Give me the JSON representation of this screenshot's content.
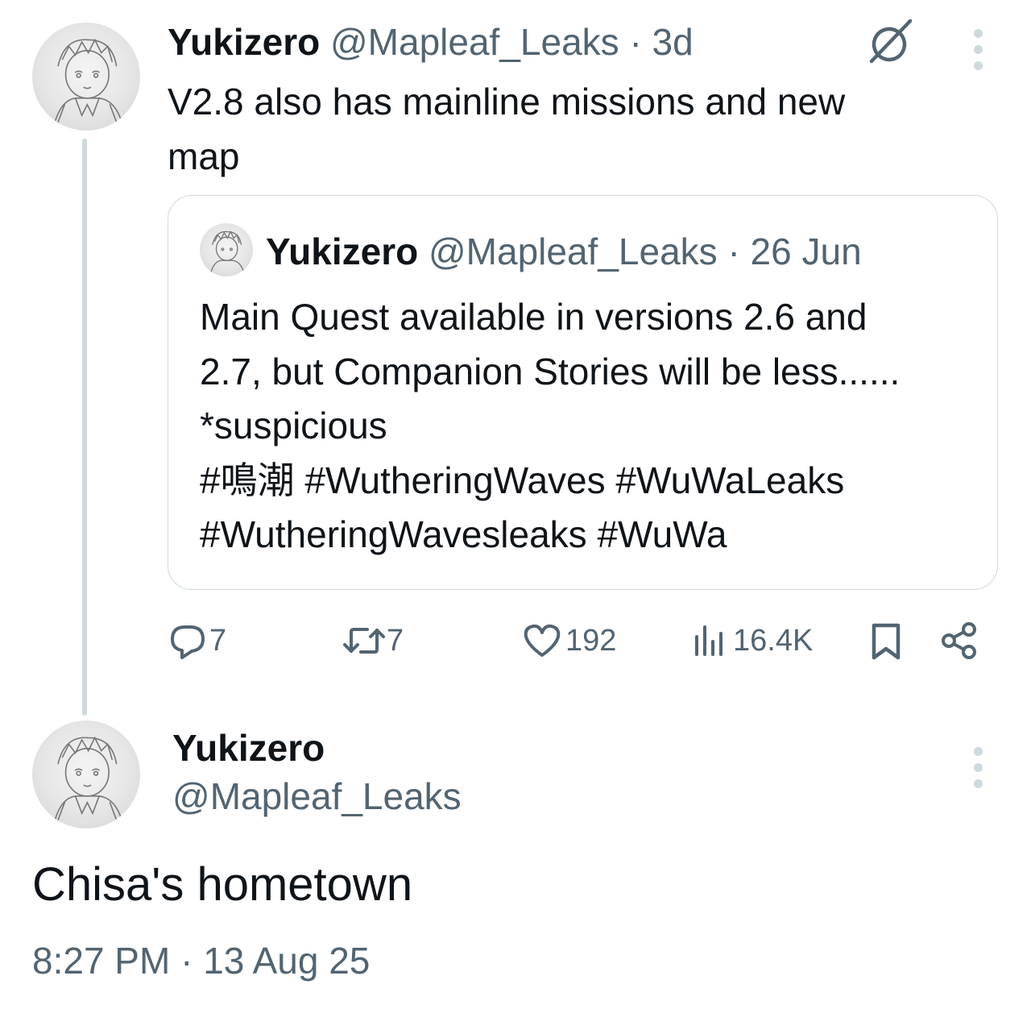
{
  "reply_tweet": {
    "display_name": "Yukizero",
    "handle_and_time": "@Mapleaf_Leaks · 3d",
    "text_line1": "V2.8 also has mainline missions and new",
    "text_line2": "map",
    "quoted": {
      "display_name": "Yukizero",
      "handle_and_time": "@Mapleaf_Leaks · 26 Jun",
      "lines": [
        "Main Quest available in versions 2.6 and",
        "2.7, but Companion Stories will be less......",
        "*suspicious",
        "#鳴潮 #WutheringWaves #WuWaLeaks",
        "#WutheringWavesleaks #WuWa"
      ]
    },
    "actions": {
      "replies": "7",
      "reposts": "7",
      "likes": "192",
      "views": "16.4K"
    }
  },
  "main_tweet": {
    "display_name": "Yukizero",
    "handle": "@Mapleaf_Leaks",
    "text": "Chisa's hometown",
    "timestamp": "8:27 PM · 13 Aug 25"
  },
  "icons": {
    "grok": "slashed-circle-icon",
    "more": "vertical-dots-icon",
    "reply": "speech-bubble-icon",
    "repost": "repost-arrows-icon",
    "like": "heart-icon",
    "views": "bar-chart-icon",
    "bookmark": "bookmark-icon",
    "share": "share-icon"
  },
  "colors": {
    "text": "#0f1419",
    "muted": "#536471",
    "line": "#cfd9de"
  }
}
